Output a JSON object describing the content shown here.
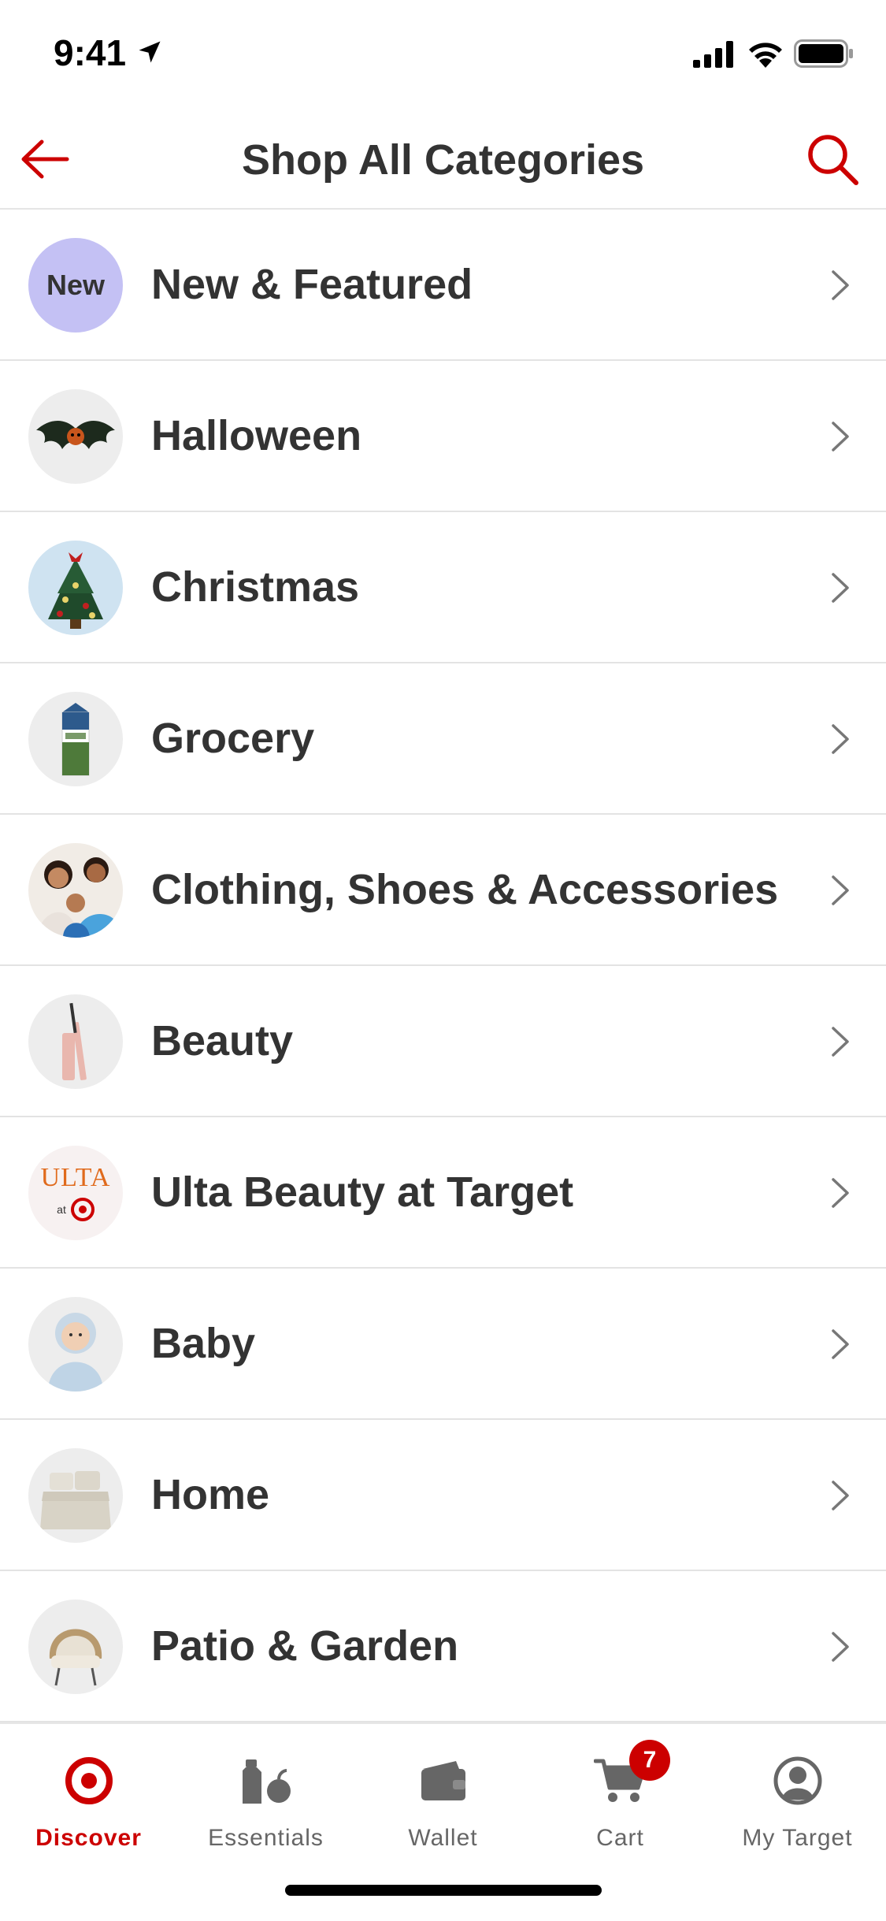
{
  "status_bar": {
    "time": "9:41",
    "icons": [
      "location-arrow-icon",
      "cellular-signal-icon",
      "wifi-icon",
      "battery-icon"
    ]
  },
  "header": {
    "title": "Shop All Categories",
    "back_icon": "arrow-left-icon",
    "search_icon": "search-icon"
  },
  "categories": [
    {
      "label": "New & Featured",
      "badge": "New"
    },
    {
      "label": "Halloween"
    },
    {
      "label": "Christmas"
    },
    {
      "label": "Grocery"
    },
    {
      "label": "Clothing, Shoes & Accessories"
    },
    {
      "label": "Beauty"
    },
    {
      "label": "Ulta Beauty at Target",
      "logo_text": "ULTA",
      "logo_sub": "at"
    },
    {
      "label": "Baby"
    },
    {
      "label": "Home"
    },
    {
      "label": "Patio & Garden"
    }
  ],
  "tab_bar": {
    "tabs": [
      {
        "label": "Discover",
        "icon": "target-bullseye-icon",
        "active": true
      },
      {
        "label": "Essentials",
        "icon": "essentials-icon"
      },
      {
        "label": "Wallet",
        "icon": "wallet-icon"
      },
      {
        "label": "Cart",
        "icon": "cart-icon",
        "badge": "7"
      },
      {
        "label": "My Target",
        "icon": "account-icon"
      }
    ]
  },
  "colors": {
    "brand_red": "#cc0000",
    "text": "#333333",
    "new_badge_bg": "#c4c1f4"
  }
}
